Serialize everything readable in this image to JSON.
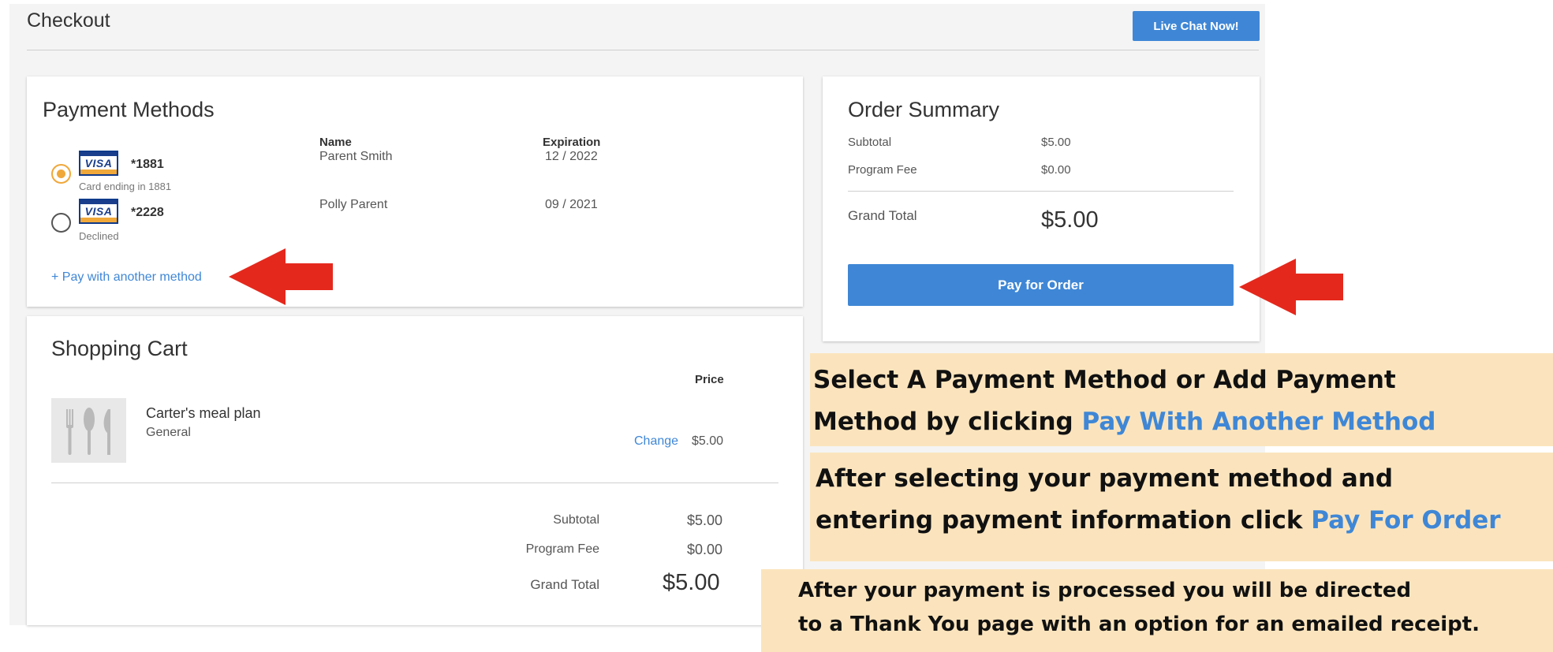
{
  "header": {
    "title": "Checkout",
    "chat_label": "Live Chat Now!"
  },
  "payment_methods": {
    "title": "Payment Methods",
    "columns": {
      "name": "Name",
      "expiration": "Expiration"
    },
    "cards": [
      {
        "brand": "VISA",
        "number": "*1881",
        "status": "Card ending in 1881",
        "name": "Parent Smith",
        "expiration": "12 / 2022",
        "selected": true
      },
      {
        "brand": "VISA",
        "number": "*2228",
        "status": "Declined",
        "name": "Polly Parent",
        "expiration": "09 / 2021",
        "selected": false
      }
    ],
    "add_link": "+ Pay with another method"
  },
  "order_summary": {
    "title": "Order Summary",
    "subtotal_label": "Subtotal",
    "subtotal_value": "$5.00",
    "fee_label": "Program Fee",
    "fee_value": "$0.00",
    "total_label": "Grand Total",
    "total_value": "$5.00",
    "pay_label": "Pay for Order"
  },
  "shopping_cart": {
    "title": "Shopping Cart",
    "price_header": "Price",
    "item": {
      "name": "Carter's meal plan",
      "category": "General",
      "change_label": "Change",
      "price": "$5.00"
    },
    "subtotal_label": "Subtotal",
    "subtotal_value": "$5.00",
    "fee_label": "Program Fee",
    "fee_value": "$0.00",
    "total_label": "Grand Total",
    "total_value": "$5.00"
  },
  "instructions": {
    "note1_line1": "Select A Payment Method or Add Payment",
    "note1_line2_prefix": "Method by clicking ",
    "note1_line2_highlight": "Pay With Another Method",
    "note2_line1": "After selecting your payment method and",
    "note2_line2_prefix": "entering payment information click ",
    "note2_line2_highlight": "Pay For Order",
    "note3_line1": "After your payment is processed you will be directed",
    "note3_line2": "to a Thank You page with an option for an emailed receipt."
  },
  "colors": {
    "accent_blue": "#3f87d6",
    "arrow_red": "#e5281c",
    "note_bg": "#fbe4bd",
    "radio_selected": "#f0a83a"
  },
  "icons": [
    "visa-card-icon",
    "radio-selected-icon",
    "radio-unselected-icon",
    "cutlery-icon",
    "red-arrow-icon"
  ]
}
